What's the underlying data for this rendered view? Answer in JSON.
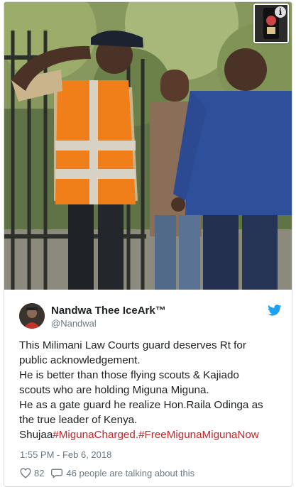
{
  "tweet": {
    "author": {
      "display_name": "Nandwa Thee IceArk™",
      "handle": "@Nandwal"
    },
    "text_lines": [
      "This Milimani Law Courts guard deserves Rt for",
      "public acknowledgement.",
      "He is better than those flying scouts & Kajiado",
      "scouts who are holding Miguna Miguna.",
      "He as a gate guard he realize Hon.Raila Odinga as",
      "the true leader of Kenya."
    ],
    "last_line_prefix": "Shujaa",
    "hashtags": [
      "#MigunaCharged",
      ".",
      "#FreeMigunaMigunaNow"
    ],
    "timestamp": "1:55 PM - Feb 6, 2018",
    "like_count": "82",
    "talking_text": "46 people are talking about this"
  },
  "icons": {
    "brand": "twitter-bird-icon",
    "media_info": "info-icon",
    "like": "heart-icon",
    "reply": "speech-bubble-icon"
  },
  "colors": {
    "hashtag": "#c0282c",
    "twitter_blue": "#1da1f2",
    "meta_text": "#697882",
    "body_text": "#1c2022"
  }
}
